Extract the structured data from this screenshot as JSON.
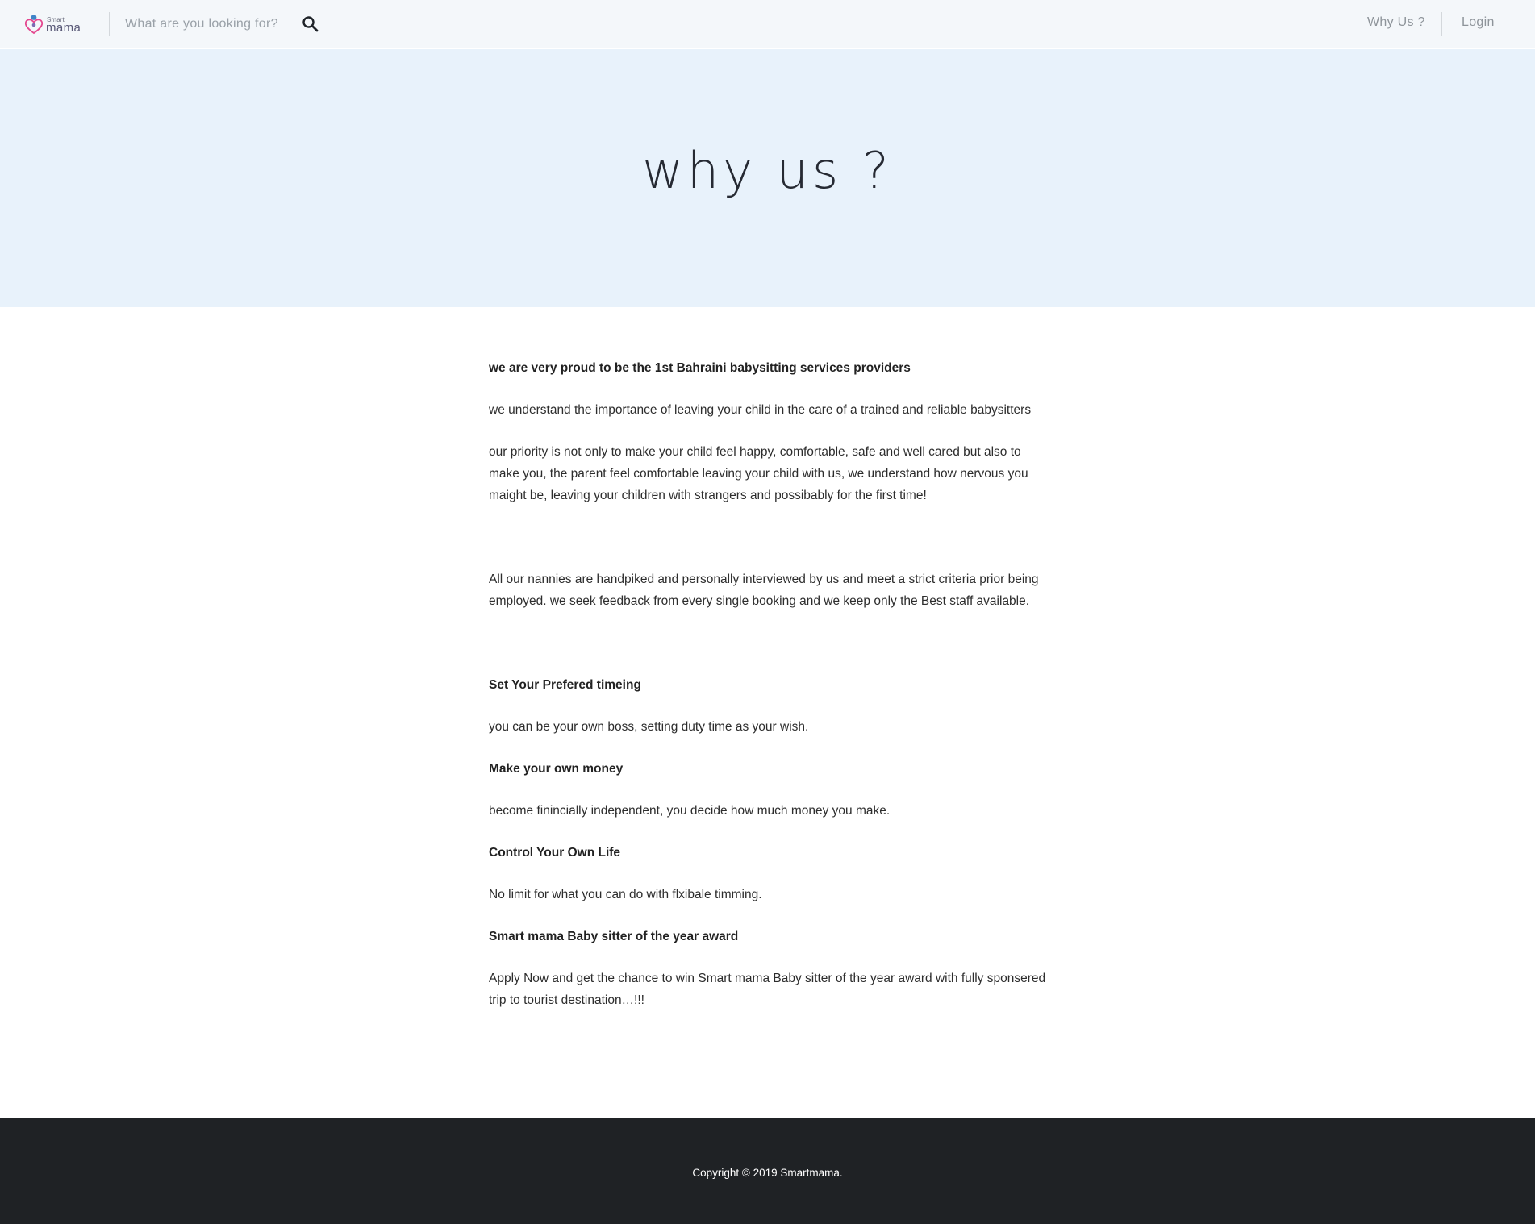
{
  "header": {
    "logo": {
      "small_text": "Smart",
      "big_text": "mama"
    },
    "search": {
      "placeholder": "What are you looking for?",
      "value": "",
      "icon": "search-icon"
    },
    "nav": {
      "why_us": "Why Us ?",
      "login": "Login"
    }
  },
  "hero": {
    "title": "why us ?"
  },
  "content": {
    "intro_heading": "we are very proud to be the 1st Bahraini babysitting services providers",
    "intro_p1": "we understand the importance of leaving your child in the care of a trained and reliable babysitters",
    "intro_p2": "our priority is not only to make your child feel happy, comfortable, safe and well cared but also to make you, the parent feel comfortable leaving your child with us, we understand how nervous you maight be, leaving your children with strangers and possibably for the first time!",
    "nannies_p": "All our nannies are handpiked and personally interviewed by us and meet a strict criteria prior being employed. we seek feedback from every single booking and we keep only the Best staff available.",
    "sections": [
      {
        "heading": "Set Your Prefered timeing",
        "text": "you can be your own boss, setting duty time as your wish."
      },
      {
        "heading": "Make your own money",
        "text": "become finincially independent, you decide how much money you make."
      },
      {
        "heading": "Control Your Own Life",
        "text": "No limit for what you can do with flxibale timming."
      },
      {
        "heading": "Smart mama Baby sitter of the year award",
        "text": "Apply Now and get the chance to win Smart mama Baby sitter of the year award with fully sponsered trip to tourist destination…!!!"
      }
    ]
  },
  "footer": {
    "copyright": "Copyright © 2019 Smartmama."
  },
  "colors": {
    "header_bg": "#f4f7fa",
    "hero_bg": "#e8f2fb",
    "footer_bg": "#1f2225",
    "text": "#2d2d2d",
    "logo_pink": "#e4478f",
    "logo_blue": "#3f84c8"
  }
}
